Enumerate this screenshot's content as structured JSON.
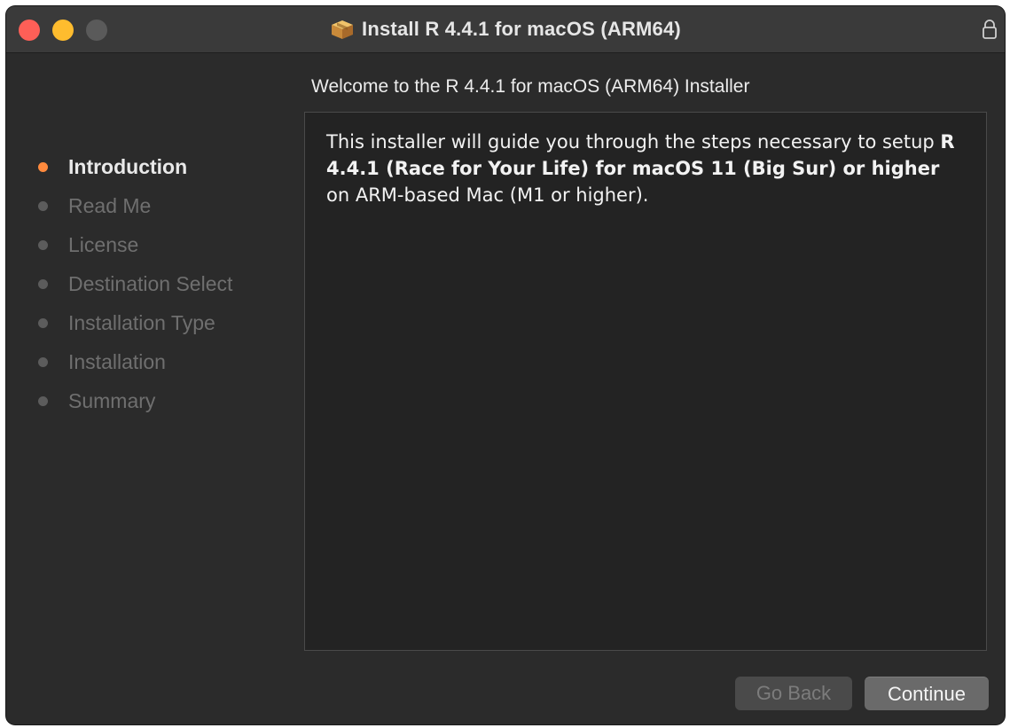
{
  "window": {
    "title": "Install R 4.4.1 for macOS (ARM64)",
    "icon": "package-icon",
    "lock_icon": "lock-icon"
  },
  "sidebar": {
    "steps": [
      {
        "label": "Introduction",
        "active": true
      },
      {
        "label": "Read Me",
        "active": false
      },
      {
        "label": "License",
        "active": false
      },
      {
        "label": "Destination Select",
        "active": false
      },
      {
        "label": "Installation Type",
        "active": false
      },
      {
        "label": "Installation",
        "active": false
      },
      {
        "label": "Summary",
        "active": false
      }
    ]
  },
  "main": {
    "heading": "Welcome to the R 4.4.1 for macOS (ARM64) Installer",
    "body": {
      "part1": "This installer will guide you through the steps necessary to setup ",
      "bold": "R 4.4.1 (Race for Your Life) for macOS 11 (Big Sur) or higher",
      "part2": " on ARM-based Mac (M1 or higher)."
    }
  },
  "buttons": {
    "back": "Go Back",
    "continue": "Continue"
  },
  "colors": {
    "active_step": "#ff8a3d",
    "close": "#fe5f57",
    "minimize": "#febc2e"
  }
}
